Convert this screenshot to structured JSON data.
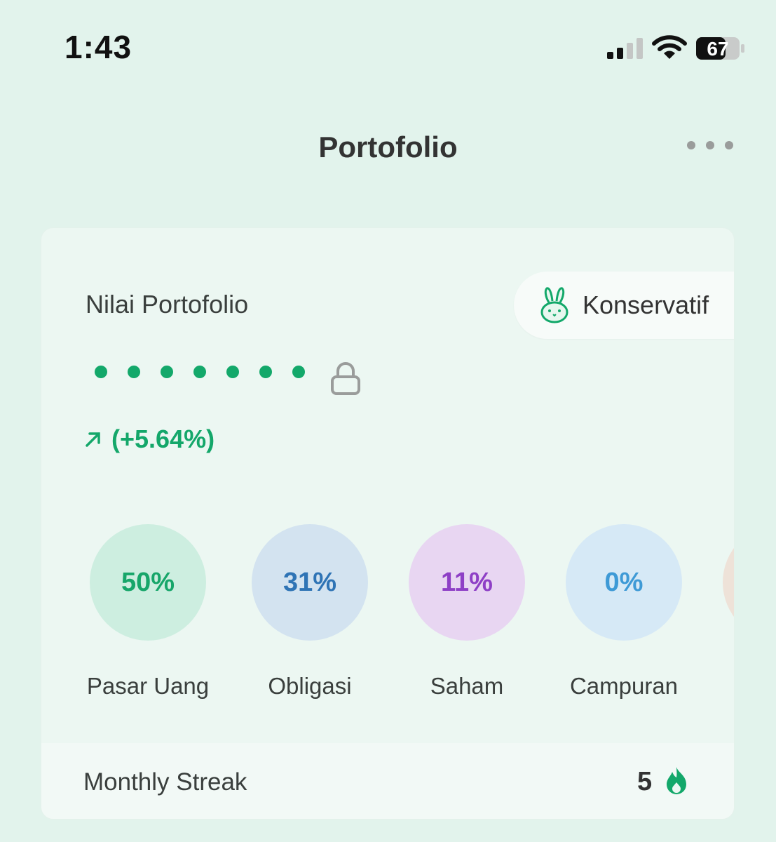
{
  "status_bar": {
    "time": "1:43",
    "battery": "67"
  },
  "header": {
    "title": "Portofolio"
  },
  "portfolio": {
    "label": "Nilai Portofolio",
    "risk_profile": "Konservatif",
    "return_text": "(+5.64%)",
    "allocations": [
      {
        "name": "Pasar Uang",
        "percent": "50%",
        "text_color": "#17a66a",
        "bg_color": "#cdeee0"
      },
      {
        "name": "Obligasi",
        "percent": "31%",
        "text_color": "#2f74b5",
        "bg_color": "#d3e3f0"
      },
      {
        "name": "Saham",
        "percent": "11%",
        "text_color": "#8e3fc6",
        "bg_color": "#e8d6f2"
      },
      {
        "name": "Campuran",
        "percent": "0%",
        "text_color": "#3e9ad6",
        "bg_color": "#d6e9f6"
      }
    ],
    "streak": {
      "label": "Monthly Streak",
      "count": "5"
    }
  },
  "colors": {
    "accent": "#13a86a",
    "background": "#e2f3ec"
  },
  "icons": [
    "signal-icon",
    "wifi-icon",
    "battery-icon",
    "more-icon",
    "rabbit-icon",
    "lock-icon",
    "arrow-up-right-icon",
    "fire-icon"
  ]
}
